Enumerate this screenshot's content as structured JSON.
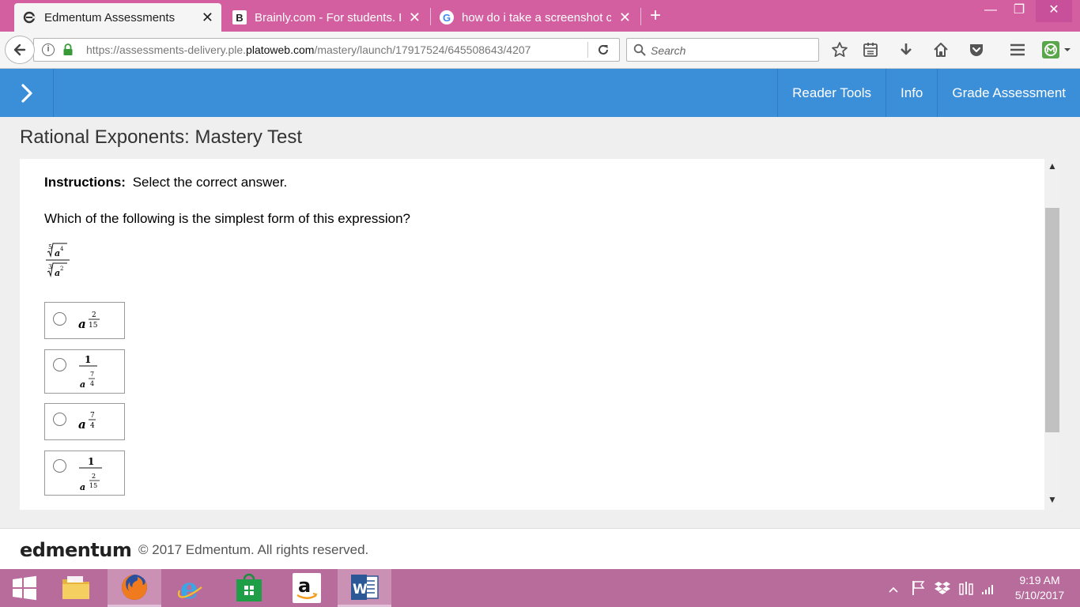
{
  "browser": {
    "tabs": [
      {
        "title": "Edmentum Assessments",
        "icon": "edmentum-favicon",
        "active": true
      },
      {
        "title": "Brainly.com - For students. B",
        "icon": "brainly-favicon",
        "active": false
      },
      {
        "title": "how do i take a screenshot c",
        "icon": "google-favicon",
        "active": false
      }
    ],
    "url_prefix": "https://assessments-delivery.ple.",
    "url_host": "platoweb.com",
    "url_path": "/mastery/launch/17917524/645508643/4207",
    "search_placeholder": "Search",
    "toolbar_icons": [
      "bookmark-star-icon",
      "reading-list-icon",
      "download-icon",
      "home-icon",
      "pocket-icon",
      "menu-icon",
      "extension-icon"
    ]
  },
  "app": {
    "nav": {
      "reader_tools": "Reader Tools",
      "info": "Info",
      "grade": "Grade Assessment"
    },
    "page_title": "Rational Exponents: Mastery Test",
    "instructions_label": "Instructions:",
    "instructions_text": "Select the correct answer.",
    "question": "Which of the following is the simplest form of this expression?",
    "expression": {
      "numerator_index": "5",
      "numerator_base": "a",
      "numerator_exp": "4",
      "denominator_index": "3",
      "denominator_base": "a",
      "denominator_exp": "2"
    },
    "options": [
      {
        "base": "a",
        "exp_num": "2",
        "exp_den": "15"
      },
      {
        "numerator": "1",
        "base": "a",
        "exp_num": "7",
        "exp_den": "4"
      },
      {
        "base": "a",
        "exp_num": "7",
        "exp_den": "4"
      },
      {
        "numerator": "1",
        "base": "a",
        "exp_num": "2",
        "exp_den": "15"
      }
    ]
  },
  "footer": {
    "logo": "edmentum",
    "copyright": "© 2017 Edmentum. All rights reserved."
  },
  "taskbar": {
    "apps": [
      "windows-start-icon",
      "file-explorer-icon",
      "firefox-icon",
      "internet-explorer-icon",
      "store-icon",
      "amazon-icon",
      "word-icon"
    ],
    "time": "9:19 AM",
    "date": "5/10/2017"
  },
  "colors": {
    "header_blue": "#3b8fd9",
    "tab_strip": "#d45fa0",
    "taskbar": "#b86c9c"
  }
}
